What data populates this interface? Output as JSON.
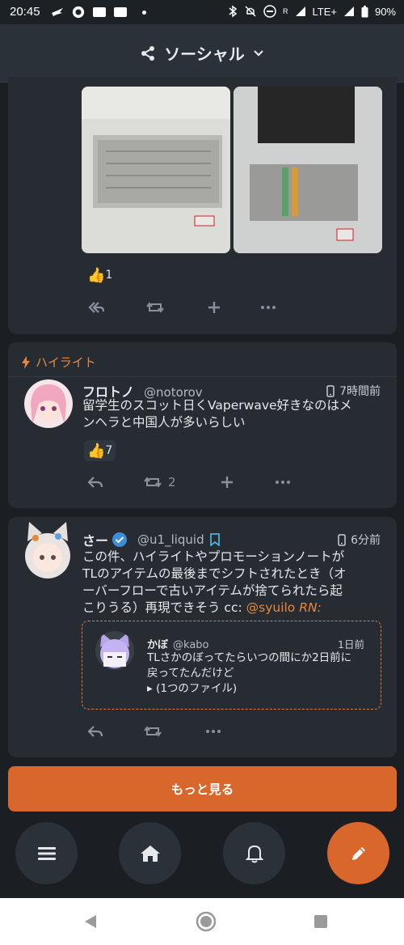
{
  "status_bar": {
    "time": "20:45",
    "network": "LTE+",
    "battery": "90%",
    "r_label": "R"
  },
  "header": {
    "title": "ソーシャル",
    "icon": "share-icon"
  },
  "notes": [
    {
      "reaction": {
        "emoji": "👍",
        "count": "1"
      }
    },
    {
      "label": "ハイライト",
      "name": "フロトノ",
      "username": "@notorov",
      "time": "7時間前",
      "text_lines": [
        "留学生のスコット日くVaperwave好きなのはメ",
        "ンヘラと中国人が多いらしい"
      ],
      "reaction": {
        "emoji": "👍",
        "count": "7"
      },
      "renote_count": "2"
    },
    {
      "name": "さー",
      "username": "@u1_liquid",
      "time": "6分前",
      "text_lines": [
        "この件、ハイライトやプロモーションノートが",
        "TLのアイテムの最後までシフトされたとき（オ",
        "ーバーフローで古いアイテムが捨てられたら起"
      ],
      "text_last_prefix": "こりうる）再現できそう cc: ",
      "mention": "@syuilo",
      "rn_label": "RN:",
      "quote": {
        "name": "かぼ",
        "username": "@kabo",
        "time": "1日前",
        "text_lines": [
          "TLさかのぼってたらいつの間にか2日前に",
          "戻ってたんだけど"
        ],
        "files": "▸ (1つのファイル)"
      }
    }
  ],
  "more_button": "もっと見る",
  "colors": {
    "accent": "#d9672b",
    "background": "#1b1e23",
    "card": "#272c33",
    "mention": "#e7873d"
  }
}
